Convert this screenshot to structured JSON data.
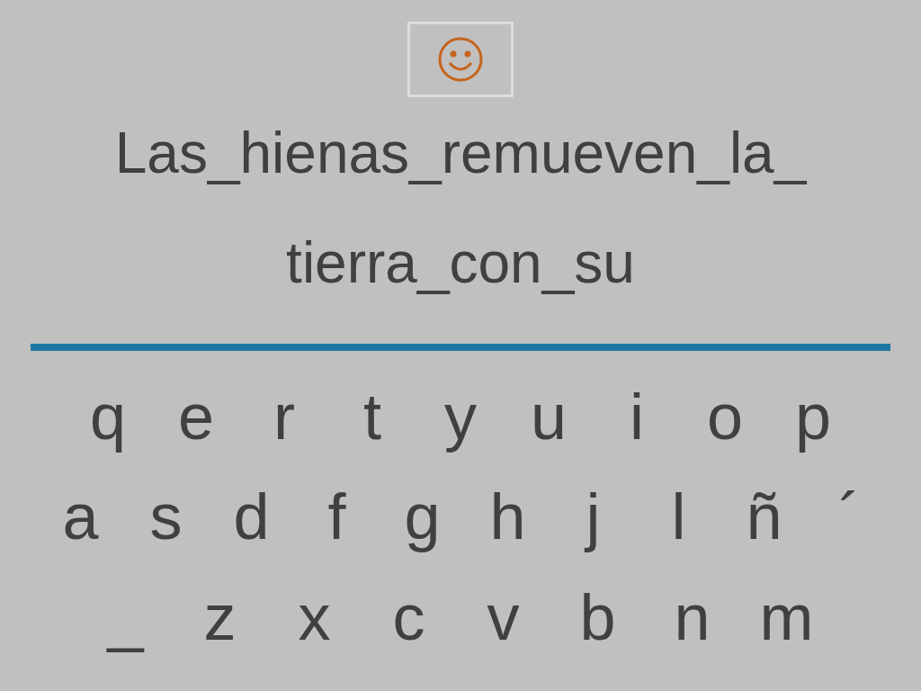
{
  "sentence_lines": [
    "Las_hienas_remueven_la_",
    "tierra_con_su"
  ],
  "keyboard": [
    [
      "q",
      "e",
      "r",
      "t",
      "y",
      "u",
      "i",
      "o",
      "p"
    ],
    [
      "a",
      "s",
      "d",
      "f",
      "g",
      "h",
      "j",
      "l",
      "ñ",
      "´"
    ],
    [
      "_",
      "z",
      "x",
      "c",
      "v",
      "b",
      "n",
      "m"
    ]
  ]
}
